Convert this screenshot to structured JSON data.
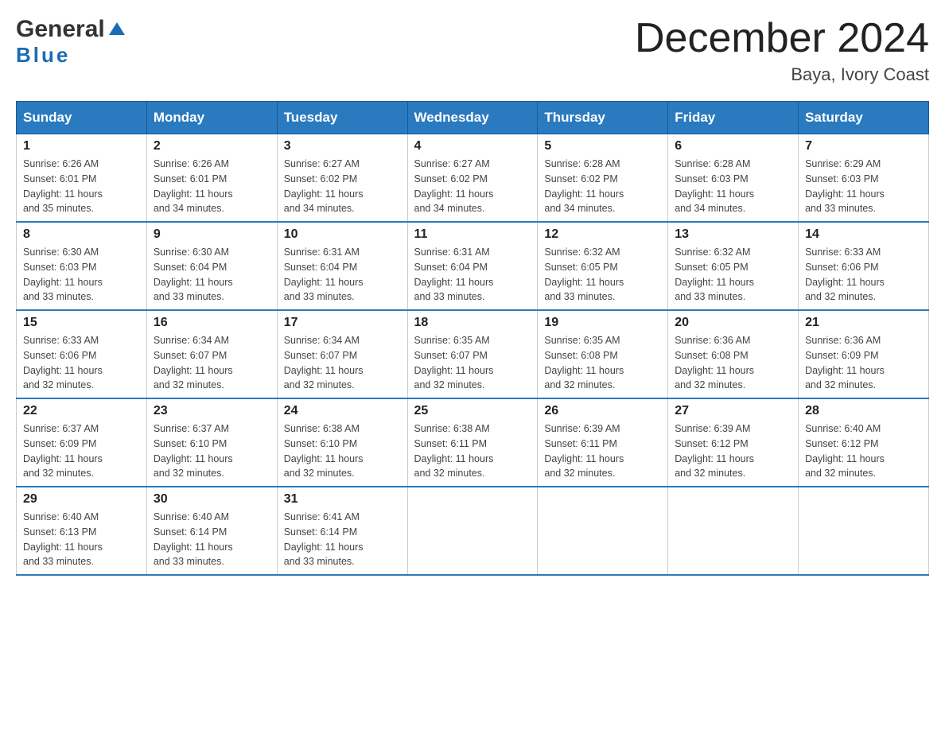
{
  "header": {
    "logo_general": "General",
    "logo_blue": "Blue",
    "month_title": "December 2024",
    "location": "Baya, Ivory Coast"
  },
  "days_of_week": [
    "Sunday",
    "Monday",
    "Tuesday",
    "Wednesday",
    "Thursday",
    "Friday",
    "Saturday"
  ],
  "weeks": [
    [
      {
        "day": "1",
        "sunrise": "6:26 AM",
        "sunset": "6:01 PM",
        "daylight": "11 hours and 35 minutes."
      },
      {
        "day": "2",
        "sunrise": "6:26 AM",
        "sunset": "6:01 PM",
        "daylight": "11 hours and 34 minutes."
      },
      {
        "day": "3",
        "sunrise": "6:27 AM",
        "sunset": "6:02 PM",
        "daylight": "11 hours and 34 minutes."
      },
      {
        "day": "4",
        "sunrise": "6:27 AM",
        "sunset": "6:02 PM",
        "daylight": "11 hours and 34 minutes."
      },
      {
        "day": "5",
        "sunrise": "6:28 AM",
        "sunset": "6:02 PM",
        "daylight": "11 hours and 34 minutes."
      },
      {
        "day": "6",
        "sunrise": "6:28 AM",
        "sunset": "6:03 PM",
        "daylight": "11 hours and 34 minutes."
      },
      {
        "day": "7",
        "sunrise": "6:29 AM",
        "sunset": "6:03 PM",
        "daylight": "11 hours and 33 minutes."
      }
    ],
    [
      {
        "day": "8",
        "sunrise": "6:30 AM",
        "sunset": "6:03 PM",
        "daylight": "11 hours and 33 minutes."
      },
      {
        "day": "9",
        "sunrise": "6:30 AM",
        "sunset": "6:04 PM",
        "daylight": "11 hours and 33 minutes."
      },
      {
        "day": "10",
        "sunrise": "6:31 AM",
        "sunset": "6:04 PM",
        "daylight": "11 hours and 33 minutes."
      },
      {
        "day": "11",
        "sunrise": "6:31 AM",
        "sunset": "6:04 PM",
        "daylight": "11 hours and 33 minutes."
      },
      {
        "day": "12",
        "sunrise": "6:32 AM",
        "sunset": "6:05 PM",
        "daylight": "11 hours and 33 minutes."
      },
      {
        "day": "13",
        "sunrise": "6:32 AM",
        "sunset": "6:05 PM",
        "daylight": "11 hours and 33 minutes."
      },
      {
        "day": "14",
        "sunrise": "6:33 AM",
        "sunset": "6:06 PM",
        "daylight": "11 hours and 32 minutes."
      }
    ],
    [
      {
        "day": "15",
        "sunrise": "6:33 AM",
        "sunset": "6:06 PM",
        "daylight": "11 hours and 32 minutes."
      },
      {
        "day": "16",
        "sunrise": "6:34 AM",
        "sunset": "6:07 PM",
        "daylight": "11 hours and 32 minutes."
      },
      {
        "day": "17",
        "sunrise": "6:34 AM",
        "sunset": "6:07 PM",
        "daylight": "11 hours and 32 minutes."
      },
      {
        "day": "18",
        "sunrise": "6:35 AM",
        "sunset": "6:07 PM",
        "daylight": "11 hours and 32 minutes."
      },
      {
        "day": "19",
        "sunrise": "6:35 AM",
        "sunset": "6:08 PM",
        "daylight": "11 hours and 32 minutes."
      },
      {
        "day": "20",
        "sunrise": "6:36 AM",
        "sunset": "6:08 PM",
        "daylight": "11 hours and 32 minutes."
      },
      {
        "day": "21",
        "sunrise": "6:36 AM",
        "sunset": "6:09 PM",
        "daylight": "11 hours and 32 minutes."
      }
    ],
    [
      {
        "day": "22",
        "sunrise": "6:37 AM",
        "sunset": "6:09 PM",
        "daylight": "11 hours and 32 minutes."
      },
      {
        "day": "23",
        "sunrise": "6:37 AM",
        "sunset": "6:10 PM",
        "daylight": "11 hours and 32 minutes."
      },
      {
        "day": "24",
        "sunrise": "6:38 AM",
        "sunset": "6:10 PM",
        "daylight": "11 hours and 32 minutes."
      },
      {
        "day": "25",
        "sunrise": "6:38 AM",
        "sunset": "6:11 PM",
        "daylight": "11 hours and 32 minutes."
      },
      {
        "day": "26",
        "sunrise": "6:39 AM",
        "sunset": "6:11 PM",
        "daylight": "11 hours and 32 minutes."
      },
      {
        "day": "27",
        "sunrise": "6:39 AM",
        "sunset": "6:12 PM",
        "daylight": "11 hours and 32 minutes."
      },
      {
        "day": "28",
        "sunrise": "6:40 AM",
        "sunset": "6:12 PM",
        "daylight": "11 hours and 32 minutes."
      }
    ],
    [
      {
        "day": "29",
        "sunrise": "6:40 AM",
        "sunset": "6:13 PM",
        "daylight": "11 hours and 33 minutes."
      },
      {
        "day": "30",
        "sunrise": "6:40 AM",
        "sunset": "6:14 PM",
        "daylight": "11 hours and 33 minutes."
      },
      {
        "day": "31",
        "sunrise": "6:41 AM",
        "sunset": "6:14 PM",
        "daylight": "11 hours and 33 minutes."
      },
      null,
      null,
      null,
      null
    ]
  ],
  "labels": {
    "sunrise": "Sunrise:",
    "sunset": "Sunset:",
    "daylight": "Daylight:"
  }
}
